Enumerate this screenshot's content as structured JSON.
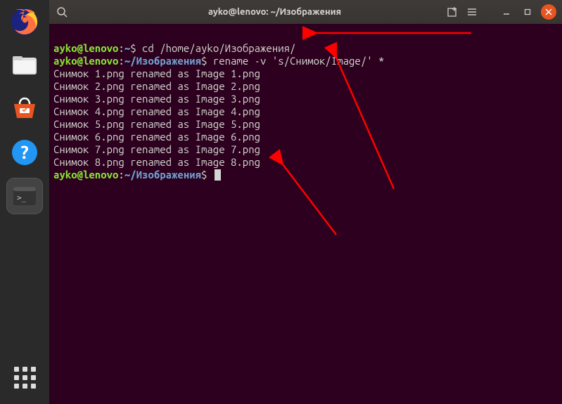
{
  "titlebar": {
    "title": "ayko@lenovo: ~/Изображения"
  },
  "dock": {
    "items": [
      {
        "name": "firefox",
        "glyph": "firefox"
      },
      {
        "name": "files",
        "glyph": "files"
      },
      {
        "name": "software",
        "glyph": "software"
      },
      {
        "name": "help",
        "glyph": "help"
      },
      {
        "name": "terminal",
        "glyph": "terminal",
        "selected": true
      }
    ]
  },
  "terminal": {
    "prompt1": {
      "user": "ayko@lenovo",
      "sep": ":",
      "path": "~",
      "command": "cd /home/ayko/Изображения/"
    },
    "prompt2": {
      "user": "ayko@lenovo",
      "sep": ":",
      "path": "~/Изображения",
      "command": "rename -v 's/Снимок/Image/' *"
    },
    "output": [
      "Снимок 1.png renamed as Image 1.png",
      "Снимок 2.png renamed as Image 2.png",
      "Снимок 3.png renamed as Image 3.png",
      "Снимок 4.png renamed as Image 4.png",
      "Снимок 5.png renamed as Image 5.png",
      "Снимок 6.png renamed as Image 6.png",
      "Снимок 7.png renamed as Image 7.png",
      "Снимок 8.png renamed as Image 8.png"
    ],
    "prompt3": {
      "user": "ayko@lenovo",
      "sep": ":",
      "path": "~/Изображения",
      "command": ""
    }
  },
  "colors": {
    "arrow": "#ff0000"
  }
}
